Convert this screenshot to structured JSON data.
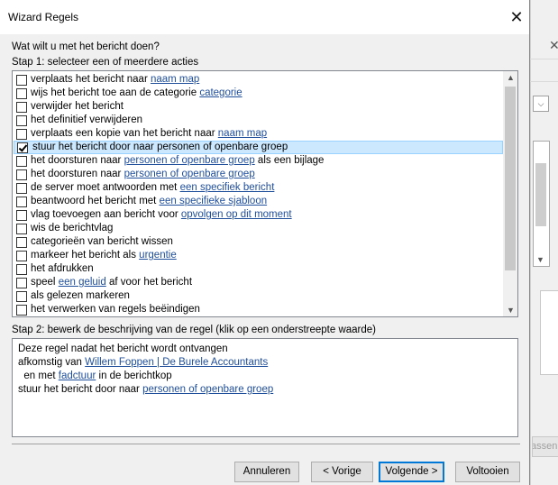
{
  "window": {
    "title": "Wizard Regels"
  },
  "question": "Wat wilt u met het bericht doen?",
  "step1_label": "Stap 1: selecteer een of meerdere acties",
  "actions": [
    {
      "text": "verplaats het bericht naar ",
      "link": "naam map",
      "after": "",
      "checked": false
    },
    {
      "text": "wijs het bericht toe aan de categorie ",
      "link": "categorie",
      "after": "",
      "checked": false
    },
    {
      "text": "verwijder het bericht",
      "link": "",
      "after": "",
      "checked": false
    },
    {
      "text": "het definitief verwijderen",
      "link": "",
      "after": "",
      "checked": false
    },
    {
      "text": "verplaats een kopie van het bericht naar ",
      "link": "naam map",
      "after": "",
      "checked": false
    },
    {
      "text": "stuur het bericht door naar personen of openbare groep",
      "link": "",
      "after": "",
      "checked": true
    },
    {
      "text": "het doorsturen naar ",
      "link": "personen of openbare groep",
      "after": " als een bijlage",
      "checked": false
    },
    {
      "text": "het doorsturen naar ",
      "link": "personen of openbare groep",
      "after": "",
      "checked": false
    },
    {
      "text": "de server moet antwoorden met ",
      "link": "een specifiek bericht",
      "after": "",
      "checked": false
    },
    {
      "text": "beantwoord het bericht met ",
      "link": "een specifieke sjabloon",
      "after": "",
      "checked": false
    },
    {
      "text": "vlag toevoegen aan bericht voor ",
      "link": "opvolgen op dit moment",
      "after": "",
      "checked": false
    },
    {
      "text": "wis de berichtvlag",
      "link": "",
      "after": "",
      "checked": false
    },
    {
      "text": "categorieën van bericht wissen",
      "link": "",
      "after": "",
      "checked": false
    },
    {
      "text": "markeer het bericht als ",
      "link": "urgentie",
      "after": "",
      "checked": false
    },
    {
      "text": "het afdrukken",
      "link": "",
      "after": "",
      "checked": false
    },
    {
      "text": "speel ",
      "link": "een geluid",
      "after": " af voor het bericht",
      "checked": false
    },
    {
      "text": "als gelezen markeren",
      "link": "",
      "after": "",
      "checked": false
    },
    {
      "text": "het verwerken van regels beëindigen",
      "link": "",
      "after": "",
      "checked": false
    }
  ],
  "step2_label": "Stap 2: bewerk de beschrijving van de regel (klik op een onderstreepte waarde)",
  "description": {
    "line1": "Deze regel nadat het bericht wordt ontvangen",
    "line2_prefix": "afkomstig van ",
    "line2_link": "Willem Foppen | De Burele Accountants",
    "line3_prefix": "  en met ",
    "line3_link": "fadctuur",
    "line3_suffix": " in de berichtkop",
    "line4_prefix": "stuur het bericht door naar ",
    "line4_link": "personen of openbare groep"
  },
  "buttons": {
    "cancel": "Annuleren",
    "back": "< Vorige",
    "next": "Volgende >",
    "finish": "Voltooien"
  },
  "background_window": {
    "button_fragment": "assen"
  },
  "colors": {
    "link": "#1f4e9a",
    "selection": "#cce8ff",
    "primary_border": "#0078d7"
  }
}
